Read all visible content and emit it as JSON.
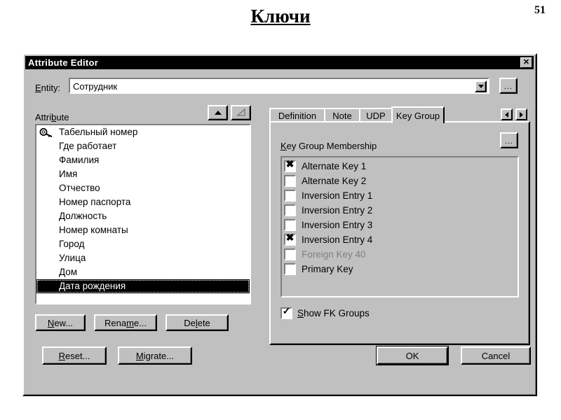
{
  "page": {
    "title": "Ключи",
    "number": "51"
  },
  "dialog": {
    "title": "Attribute Editor",
    "close_label": "✕",
    "entity": {
      "label_pre": "E",
      "label_acc": "",
      "label": "Entity:",
      "value": "Сотрудник",
      "dropdown_icon": "chevron-down-icon",
      "browse_label": "..."
    },
    "attribute_panel": {
      "label": "Attribute",
      "move_up_icon": "arrow-up-icon",
      "move_down_icon": "arrow-down-icon-disabled",
      "items": [
        {
          "label": "Табельный номер",
          "icon": "key-icon",
          "selected": false
        },
        {
          "label": "Где работает",
          "icon": "",
          "selected": false
        },
        {
          "label": "Фамилия",
          "icon": "",
          "selected": false
        },
        {
          "label": "Имя",
          "icon": "",
          "selected": false
        },
        {
          "label": "Отчество",
          "icon": "",
          "selected": false
        },
        {
          "label": "Номер паспорта",
          "icon": "",
          "selected": false
        },
        {
          "label": "Должность",
          "icon": "",
          "selected": false
        },
        {
          "label": "Номер комнаты",
          "icon": "",
          "selected": false
        },
        {
          "label": "Город",
          "icon": "",
          "selected": false
        },
        {
          "label": "Улица",
          "icon": "",
          "selected": false
        },
        {
          "label": "Дом",
          "icon": "",
          "selected": false
        },
        {
          "label": "Дата рождения",
          "icon": "",
          "selected": true
        }
      ],
      "buttons": {
        "new": "New...",
        "rename": "Rename...",
        "delete": "Delete"
      }
    },
    "tabs": [
      {
        "label": "Definition",
        "active": false
      },
      {
        "label": "Note",
        "active": false
      },
      {
        "label": "UDP",
        "active": false
      },
      {
        "label": "Key Group",
        "active": true
      }
    ],
    "tab_scroll": {
      "left_icon": "triangle-left-icon",
      "right_icon": "triangle-right-icon"
    },
    "key_group_tab": {
      "group_label": "Key Group Membership",
      "browse_label": "...",
      "items": [
        {
          "label": "Alternate Key 1",
          "checked": true,
          "mark": "✖",
          "disabled": false
        },
        {
          "label": "Alternate Key 2",
          "checked": false,
          "mark": "",
          "disabled": false
        },
        {
          "label": "Inversion Entry 1",
          "checked": false,
          "mark": "",
          "disabled": false
        },
        {
          "label": "Inversion Entry 2",
          "checked": false,
          "mark": "",
          "disabled": false
        },
        {
          "label": "Inversion Entry 3",
          "checked": false,
          "mark": "",
          "disabled": false
        },
        {
          "label": "Inversion Entry 4",
          "checked": true,
          "mark": "✖",
          "disabled": false
        },
        {
          "label": "Foreign Key 40",
          "checked": false,
          "mark": "",
          "disabled": true
        },
        {
          "label": "Primary Key",
          "checked": false,
          "mark": "",
          "disabled": false
        }
      ],
      "show_fk_groups": {
        "label": "Show FK Groups",
        "checked": true,
        "mark": "✓"
      }
    },
    "footer_buttons": {
      "reset": "Reset...",
      "migrate": "Migrate...",
      "ok": "OK",
      "cancel": "Cancel"
    }
  },
  "colors": {
    "face": "#c0c0c0",
    "titlebar": "#000000",
    "selection": "#000000",
    "disabled_text": "#808080"
  }
}
